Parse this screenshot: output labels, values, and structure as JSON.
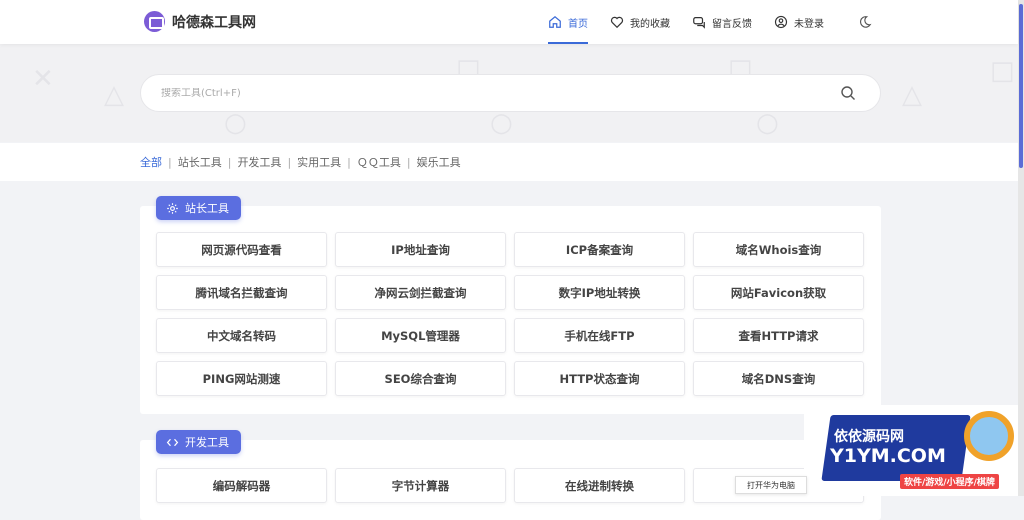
{
  "app": {
    "logo_text": "哈德森工具网"
  },
  "nav": {
    "home": "首页",
    "favorites": "我的收藏",
    "feedback": "留言反馈",
    "login": "未登录"
  },
  "search": {
    "placeholder": "搜索工具(Ctrl+F)"
  },
  "categories": [
    "全部",
    "站长工具",
    "开发工具",
    "实用工具",
    "ＱＱ工具",
    "娱乐工具"
  ],
  "panels": [
    {
      "title": "站长工具",
      "icon": "gear-icon",
      "tools": [
        "网页源代码查看",
        "IP地址查询",
        "ICP备案查询",
        "域名Whois查询",
        "腾讯域名拦截查询",
        "净网云剑拦截查询",
        "数字IP地址转换",
        "网站Favicon获取",
        "中文域名转码",
        "MySQL管理器",
        "手机在线FTP",
        "查看HTTP请求",
        "PING网站测速",
        "SEO综合查询",
        "HTTP状态查询",
        "域名DNS查询"
      ]
    },
    {
      "title": "开发工具",
      "icon": "code-icon",
      "tools": [
        "编码解码器",
        "字节计算器",
        "在线进制转换",
        ""
      ]
    }
  ],
  "ad": {
    "line1": "依依源码网",
    "line2": "Y1YM.COM",
    "line3": "软件/游戏/小程序/棋牌"
  },
  "tooltip": "打开华为电脑",
  "colors": {
    "accent": "#3a6ad8",
    "badge": "#5b6ee0"
  }
}
